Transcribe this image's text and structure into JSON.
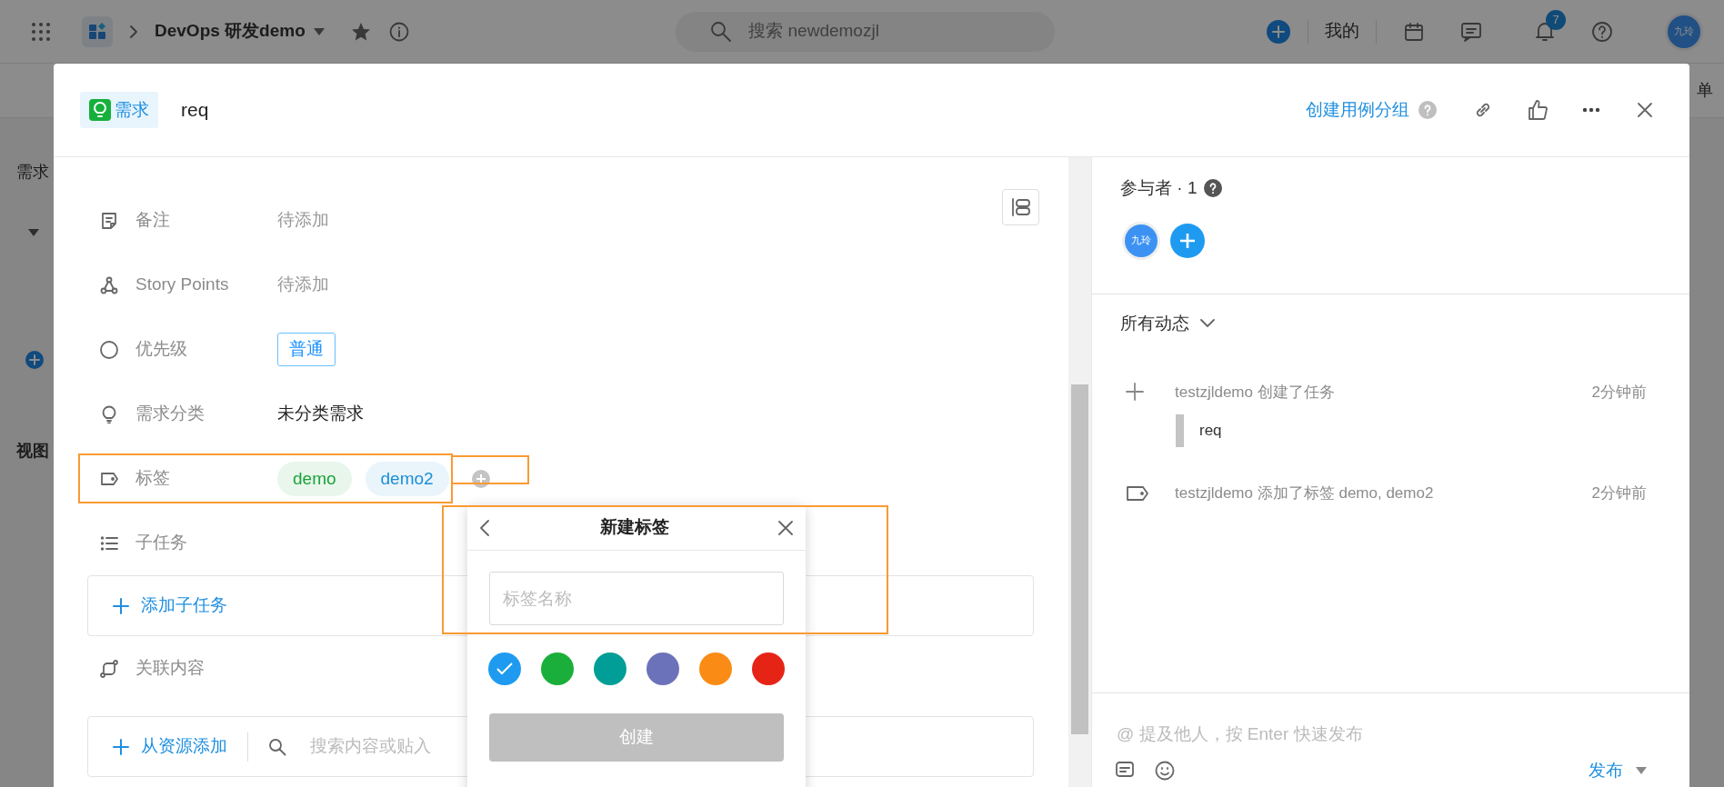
{
  "topbar": {
    "project": "DevOps 研发demo",
    "search": {
      "placeholder": "搜索 newdemozjl"
    },
    "my_label": "我的",
    "notification_count": "7",
    "avatar": "九玲"
  },
  "background": {
    "section_title": "需求",
    "view_title": "视图",
    "right_text": "单"
  },
  "modal": {
    "type_chip": "需求",
    "title": "req",
    "create_group_link": "创建用例分组",
    "fields": [
      {
        "label": "备注",
        "kind": "empty",
        "placeholder": "待添加",
        "highlighted": false
      },
      {
        "label": "Story Points",
        "kind": "empty",
        "placeholder": "待添加",
        "highlighted": false
      },
      {
        "label": "优先级",
        "kind": "outlined",
        "value": "普通",
        "highlighted": false
      },
      {
        "label": "需求分类",
        "kind": "text",
        "value": "未分类需求",
        "highlighted": false
      },
      {
        "label": "标签",
        "kind": "tags",
        "tags": [
          {
            "text": "demo",
            "color": "#1aa33a"
          },
          {
            "text": "demo2",
            "color": "#1b8fd6"
          }
        ],
        "add_highlighted": true,
        "highlighted": true
      },
      {
        "label": "子任务",
        "kind": "subtasks",
        "action": "添加子任务",
        "highlighted": false
      },
      {
        "label": "关联内容",
        "kind": "relations",
        "action": "从资源添加",
        "search_placeholder": "搜索内容或贴入",
        "highlighted": false
      }
    ],
    "popover": {
      "title": "新建标签",
      "input": {
        "placeholder": "标签名称"
      },
      "highlighted": true,
      "colors": [
        {
          "color": "#1e9bf0",
          "selected": true
        },
        {
          "color": "#1aaf3a",
          "selected": false
        },
        {
          "color": "#009e96",
          "selected": false
        },
        {
          "color": "#6c72b9",
          "selected": false
        },
        {
          "color": "#fa8c16",
          "selected": false
        },
        {
          "color": "#e62416",
          "selected": false
        }
      ],
      "create_button": {
        "label": "创建",
        "disabled": true
      }
    },
    "participants": {
      "title": "参与者 · 1",
      "members": [
        {
          "initials": "九玲"
        }
      ]
    },
    "activity": {
      "filter": "所有动态",
      "items": [
        {
          "kind": "create",
          "text": "testzjldemo 创建了任务",
          "time": "2分钟前",
          "quote": "req"
        },
        {
          "kind": "tag",
          "text": "testzjldemo 添加了标签 demo, demo2",
          "time": "2分钟前"
        }
      ]
    },
    "comment": {
      "placeholder": "@ 提及他人，按 Enter 快速发布",
      "submit": "发布"
    }
  }
}
